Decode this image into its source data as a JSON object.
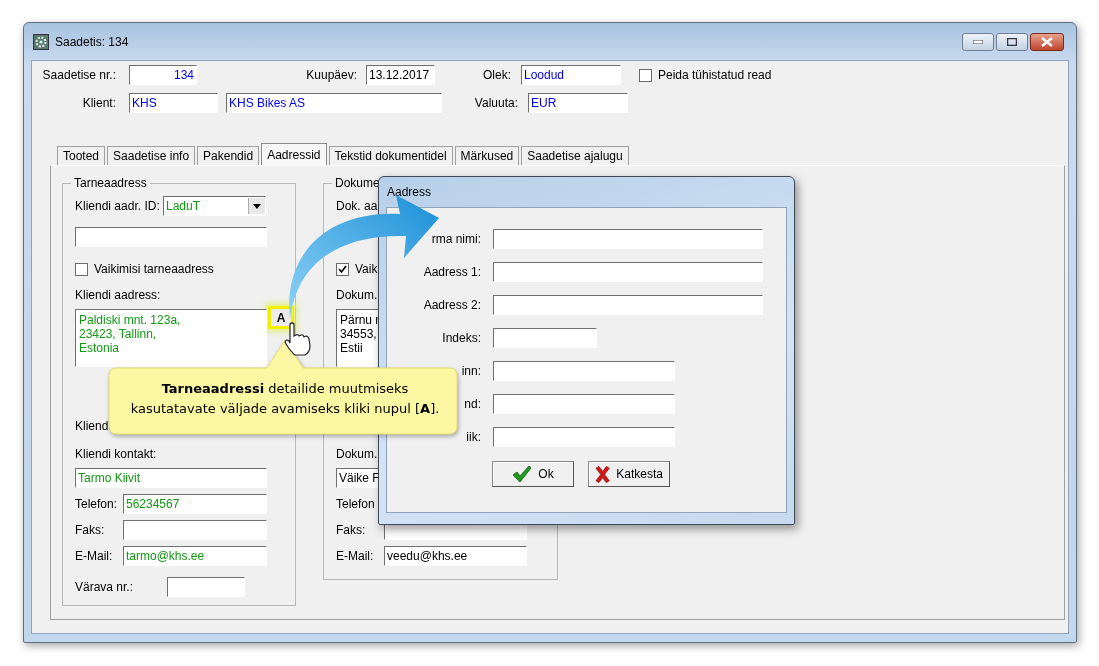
{
  "window": {
    "title": "Saadetis: 134"
  },
  "header": {
    "number": {
      "label": "Saadetise nr.:",
      "value": "134"
    },
    "date": {
      "label": "Kuupäev:",
      "value": "13.12.2017"
    },
    "status": {
      "label": "Olek:",
      "value": "Loodud"
    },
    "hide_cancelled": {
      "label": "Peida tühistatud read",
      "checked": false
    },
    "client": {
      "label": "Klient:",
      "code": "KHS",
      "name": "KHS Bikes AS"
    },
    "currency": {
      "label": "Valuuta:",
      "value": "EUR"
    }
  },
  "tabs": [
    {
      "label": "Tooted",
      "selected": false
    },
    {
      "label": "Saadetise info",
      "selected": false
    },
    {
      "label": "Pakendid",
      "selected": false
    },
    {
      "label": "Aadressid",
      "selected": true
    },
    {
      "label": "Tekstid dokumentidel",
      "selected": false
    },
    {
      "label": "Märkused",
      "selected": false
    },
    {
      "label": "Saadetise ajalugu",
      "selected": false
    }
  ],
  "delivery_address": {
    "legend": "Tarneaadress",
    "address_id": {
      "label": "Kliendi aadr. ID:",
      "value": "LaduT"
    },
    "default": {
      "label": "Vaikimisi tarneaadress",
      "checked": false
    },
    "address": {
      "label": "Kliendi aadress:",
      "lines": [
        "Paldiski mnt. 123a,",
        "23423, Tallinn,",
        "Estonia"
      ],
      "button": "A"
    },
    "hidden_row_label": "Kliendi",
    "contact": {
      "label": "Kliendi kontakt:",
      "value": "Tarmo Kiivit"
    },
    "phone": {
      "label": "Telefon:",
      "value": "56234567"
    },
    "fax": {
      "label": "Faks:"
    },
    "email": {
      "label": "E-Mail:",
      "value": "tarmo@khs.ee"
    },
    "gate": {
      "label": "Värava nr.:"
    }
  },
  "document_address": {
    "legend": "Dokume",
    "address_id_label": "Dok. aa",
    "default": {
      "label": "Vaik",
      "checked": true
    },
    "address": {
      "label": "Dokum.",
      "lines": [
        "Pärnu r",
        "34553,",
        "Estii"
      ]
    },
    "contact": {
      "label": "Dokum.",
      "value": "Väike F"
    },
    "phone_label": "Telefon",
    "fax": {
      "label": "Faks:"
    },
    "email": {
      "label": "E-Mail:",
      "value": "veedu@khs.ee"
    }
  },
  "dialog": {
    "title": "Aadress",
    "fields": [
      {
        "label": "rma nimi:",
        "kind": "wide"
      },
      {
        "label": "Aadress 1:",
        "kind": "wide"
      },
      {
        "label": "Aadress 2:",
        "kind": "wide"
      },
      {
        "label": "Indeks:",
        "kind": "short"
      },
      {
        "label": "inn:",
        "kind": "medium"
      },
      {
        "label": "nd:",
        "kind": "medium"
      },
      {
        "label": "iik:",
        "kind": "medium"
      }
    ],
    "buttons": [
      {
        "label": "Ok",
        "kind": "ok"
      },
      {
        "label": "Katkesta",
        "kind": "cancel"
      }
    ]
  },
  "callout": {
    "text": "**Tarneaadressi** detailide muutmiseks kasutatavate väljade avamiseks kliki nupul [**A**]."
  }
}
